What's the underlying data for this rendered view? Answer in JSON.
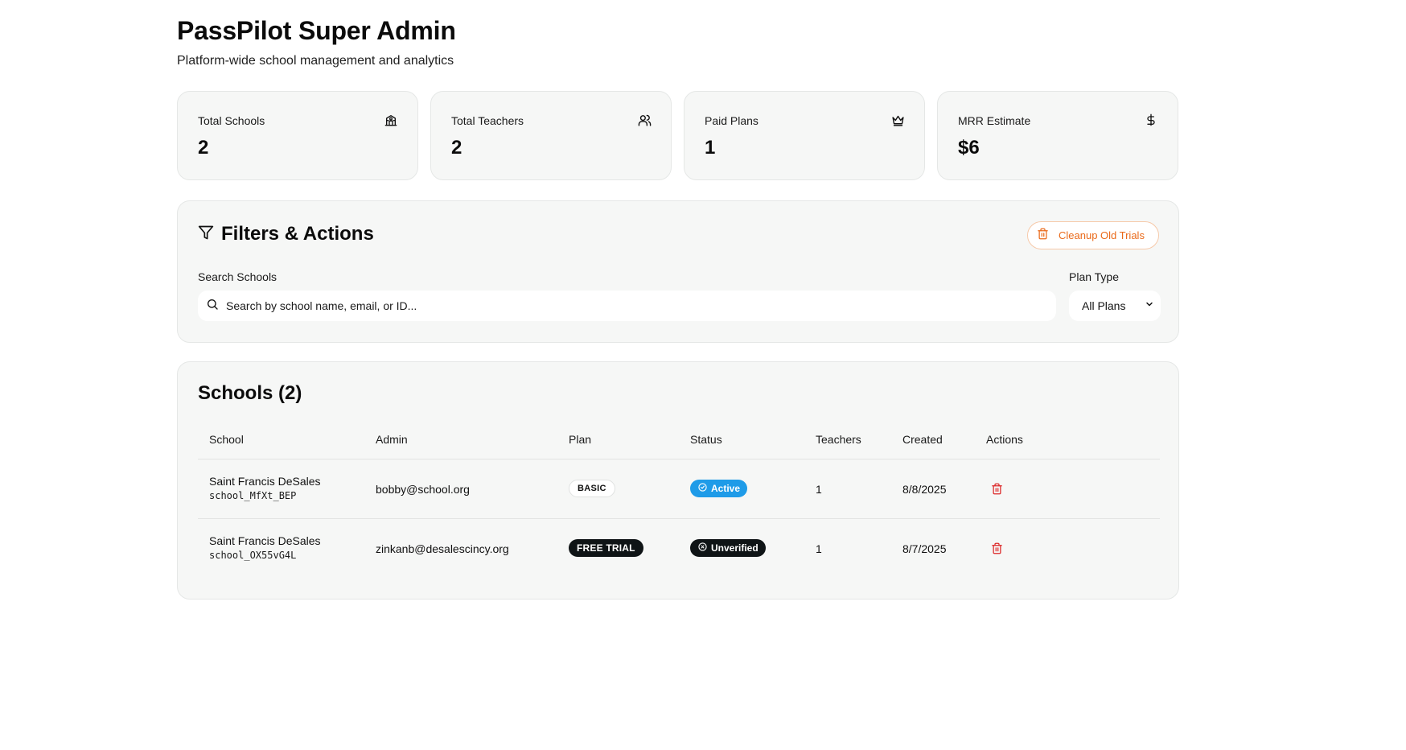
{
  "header": {
    "title": "PassPilot Super Admin",
    "subtitle": "Platform-wide school management and analytics"
  },
  "stats": [
    {
      "label": "Total Schools",
      "value": "2",
      "icon": "school-icon"
    },
    {
      "label": "Total Teachers",
      "value": "2",
      "icon": "users-icon"
    },
    {
      "label": "Paid Plans",
      "value": "1",
      "icon": "crown-icon"
    },
    {
      "label": "MRR Estimate",
      "value": "$6",
      "icon": "dollar-icon"
    }
  ],
  "filters": {
    "title": "Filters & Actions",
    "cleanup_label": "Cleanup Old Trials",
    "search_label": "Search Schools",
    "search_placeholder": "Search by school name, email, or ID...",
    "plan_label": "Plan Type",
    "plan_value": "All Plans"
  },
  "schools": {
    "title": "Schools (2)",
    "columns": [
      "School",
      "Admin",
      "Plan",
      "Status",
      "Teachers",
      "Created",
      "Actions"
    ],
    "rows": [
      {
        "name": "Saint Francis DeSales",
        "id": "school_MfXt_BEP",
        "admin": "bobby@school.org",
        "plan": "BASIC",
        "status": "Active",
        "teachers": "1",
        "created": "8/8/2025"
      },
      {
        "name": "Saint Francis DeSales",
        "id": "school_OX55vG4L",
        "admin": "zinkanb@desalescincy.org",
        "plan": "FREE TRIAL",
        "status": "Unverified",
        "teachers": "1",
        "created": "8/7/2025"
      }
    ]
  },
  "colors": {
    "active": "#1e9be8",
    "unverified": "#0f1416",
    "danger": "#dc2626",
    "warning": "#ea6a1a"
  }
}
